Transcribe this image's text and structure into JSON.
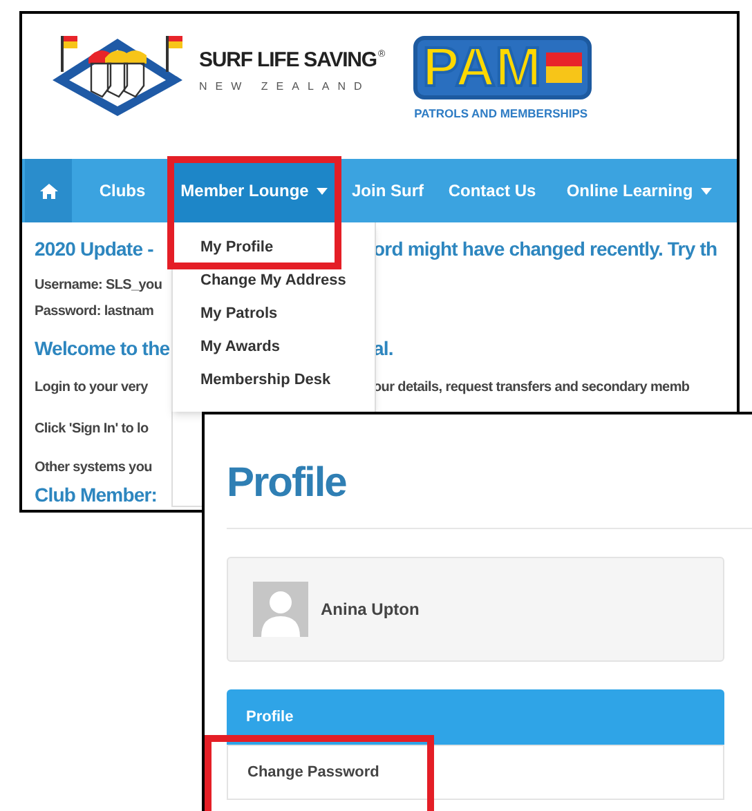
{
  "site_header": {
    "brand": "SURF LIFE SAVING",
    "brand_mark": "®",
    "brand_sub": "NEW ZEALAND",
    "app_logo": "PAM",
    "app_tagline": "PATROLS AND MEMBERSHIPS"
  },
  "nav": [
    {
      "kind": "home",
      "selected": true,
      "expanded": false
    },
    {
      "kind": "link",
      "label": "Clubs",
      "selected": false,
      "expanded": false
    },
    {
      "kind": "menu",
      "label": "Member Lounge",
      "selected": false,
      "expanded": true,
      "callout": true
    },
    {
      "kind": "link",
      "label": "Join Surf",
      "selected": false,
      "expanded": false
    },
    {
      "kind": "link",
      "label": "Contact Us",
      "selected": false,
      "expanded": false
    },
    {
      "kind": "menu",
      "label": "Online Learning",
      "selected": false,
      "expanded": false
    }
  ],
  "dropdown": [
    {
      "label": "My Profile"
    },
    {
      "label": "Change My Address"
    },
    {
      "label": "My Patrols"
    },
    {
      "label": "My Awards"
    },
    {
      "label": "Membership Desk"
    }
  ],
  "content": [
    {
      "kind": "heading",
      "left": "2020 Update -",
      "right": "ord might have changed recently. Try th"
    },
    {
      "kind": "text",
      "left": "Username: SLS_you"
    },
    {
      "kind": "text",
      "left": "Password: lastnam"
    },
    {
      "kind": "heading",
      "left": "Welcome to the",
      "right": "al."
    },
    {
      "kind": "text",
      "left": "Login to your very",
      "right": "our details, request transfers and secondary memb"
    },
    {
      "kind": "text",
      "left": "Click 'Sign In' to lo"
    },
    {
      "kind": "text",
      "left": "Other systems you"
    },
    {
      "kind": "heading",
      "left": "Club Member:"
    }
  ],
  "profile": {
    "title": "Profile",
    "user_name": "Anina Upton",
    "menu": [
      {
        "label": "Profile",
        "selected": true,
        "callout": false
      },
      {
        "label": "Change Password",
        "selected": false,
        "callout": true
      }
    ]
  }
}
